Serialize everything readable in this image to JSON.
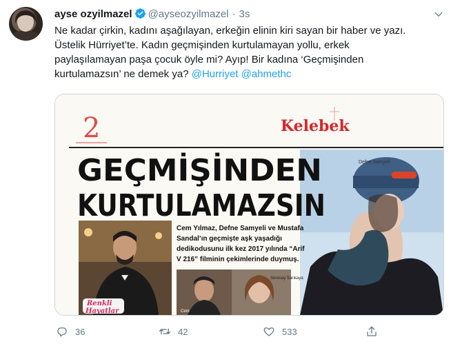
{
  "tweet": {
    "author_name": "ayse ozyilmazel",
    "handle": "@ayseozyilmazel",
    "separator": "·",
    "time": "3s",
    "body_line1": "Ne kadar çirkin, kadını aşağılayan, erkeğin elinin kiri sayan bir haber ve yazı.",
    "body_line2": "Üstelik Hürriyet’te. Kadın geçmişinden kurtulamayan yollu, erkek",
    "body_line3": "paylaşılamayan paşa çocuk öyle mi? Ayıp! Bir kadına ‘Geçmişinden",
    "body_line4": "kurtulamazsın’ ne demek ya?",
    "mention1": "@Hurriyet",
    "mention2": "@ahmethc"
  },
  "clipping": {
    "page_number": "2",
    "logo": "Kelebek",
    "headline1": "GEÇMİŞİNDEN",
    "headline2": "KURTULAMAZSIN",
    "lead1": "Cem Yılmaz, Defne Samyeli ve Mustafa",
    "lead2": "Sandal’ın geçmişte aşk yaşadığı",
    "lead3": "dedikodusunu ilk kez 2017 yılında “Arif",
    "lead4": "V 216” filminin çekimlerinde duymuş.",
    "caption_right": "Defne Samyeli",
    "caption_small1": "Serenay Sarıkaya",
    "caption_small2": "Cem",
    "badge1": "Renkli",
    "badge2": "Hayatlar"
  },
  "actions": {
    "reply_count": "36",
    "retweet_count": "42",
    "like_count": "533"
  },
  "colors": {
    "link": "#1da1f2",
    "muted": "#657786",
    "verified": "#1da1f2",
    "badge": "#e0245e"
  }
}
